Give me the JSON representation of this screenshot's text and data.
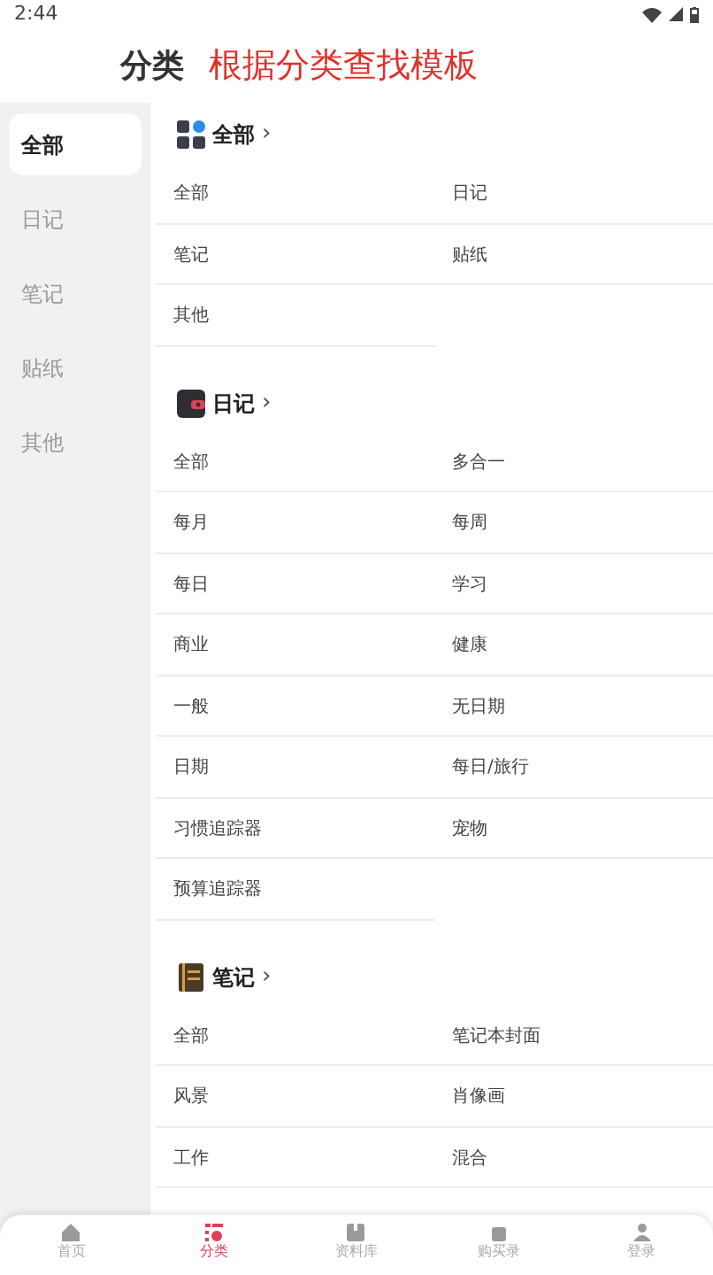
{
  "status_bar": {
    "time": "2:44"
  },
  "header": {
    "title": "分类",
    "subtitle": "根据分类查找模板"
  },
  "sidebar": {
    "items": [
      {
        "label": "全部",
        "selected": true
      },
      {
        "label": "日记",
        "selected": false
      },
      {
        "label": "笔记",
        "selected": false
      },
      {
        "label": "贴纸",
        "selected": false
      },
      {
        "label": "其他",
        "selected": false
      }
    ]
  },
  "sections": [
    {
      "title": "全部",
      "chevron": "›",
      "kind": "grid",
      "items": [
        "全部",
        "日记",
        "笔记",
        "贴纸",
        "其他"
      ]
    },
    {
      "title": "日记",
      "chevron": "›",
      "kind": "diary",
      "items": [
        "全部",
        "多合一",
        "每月",
        "每周",
        "每日",
        "学习",
        "商业",
        "健康",
        "一般",
        "无日期",
        "日期",
        "每日/旅行",
        "习惯追踪器",
        "宠物",
        "预算追踪器"
      ]
    },
    {
      "title": "笔记",
      "chevron": "›",
      "kind": "notebook",
      "items": [
        "全部",
        "笔记本封面",
        "风景",
        "肖像画",
        "工作",
        "混合"
      ]
    }
  ],
  "bottom_nav": [
    {
      "label": "首页",
      "kind": "home",
      "selected": false
    },
    {
      "label": "分类",
      "kind": "category",
      "selected": true
    },
    {
      "label": "资料库",
      "kind": "library",
      "selected": false
    },
    {
      "label": "购买录",
      "kind": "cart",
      "selected": false
    },
    {
      "label": "登录",
      "kind": "user",
      "selected": false
    }
  ]
}
